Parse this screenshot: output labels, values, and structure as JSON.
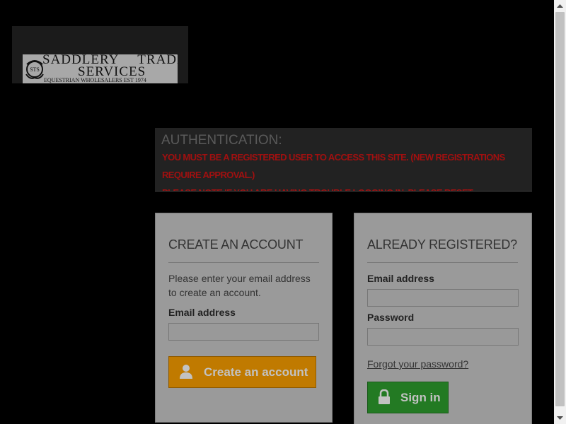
{
  "logo": {
    "line1_a": "SADDLERY",
    "line1_b": "TRADE",
    "line2": "SERVICES",
    "tagline": "EQUESTRIAN WHOLESALERS EST 1974",
    "mark": "STS"
  },
  "auth": {
    "title": "AUTHENTICATION:",
    "messages": [
      "YOU MUST BE A REGISTERED USER TO ACCESS THIS SITE. (NEW REGISTRATIONS REQUIRE APPROVAL.)",
      "PLEASE NOTE IF YOU ARE HAVING TROUBLE LOGGING IN, PLEASE RESET PASSWORD"
    ]
  },
  "create_account": {
    "heading": "CREATE AN ACCOUNT",
    "description": "Please enter your email address to create an account.",
    "email_label": "Email address",
    "email_value": "",
    "button_label": "Create an account",
    "button_icon": "user-icon",
    "button_color": "#c07a00"
  },
  "login": {
    "heading": "ALREADY REGISTERED?",
    "email_label": "Email address",
    "email_value": "",
    "password_label": "Password",
    "password_value": "",
    "forgot_label": "Forgot your password?",
    "button_label": "Sign in",
    "button_icon": "lock-icon",
    "button_color": "#237a23"
  },
  "colors": {
    "background": "#000000",
    "error_text": "#a01010",
    "panel": "#9a9a9a"
  }
}
